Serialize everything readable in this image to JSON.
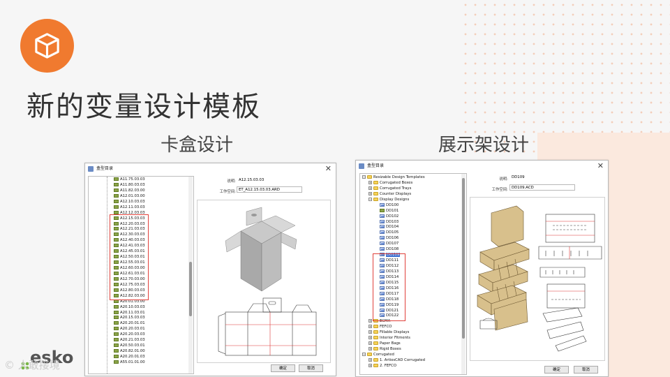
{
  "slide": {
    "title": "新的变量设计模板",
    "left_subtitle": "卡盒设计",
    "right_subtitle": "展示架设计",
    "brand": "esko",
    "watermark": "© 人敢接境"
  },
  "colors": {
    "accent": "#f07a2f",
    "highlight_box": "#e0403a",
    "selection": "#3b6fd1"
  },
  "left_window": {
    "title": "盒型目录",
    "close_glyph": "✕",
    "desc_label": "说明:",
    "desc_value": "A12.15.03.03",
    "workspace_label": "工作空间:",
    "workspace_value": "ET_A12.15.03.03.ARD",
    "ok_label": "确定",
    "cancel_label": "取消",
    "tree_items": [
      "A11.75.03.03",
      "A11.80.03.03",
      "A11.82.03.00",
      "A12.01.03.00",
      "A12.10.03.03",
      "A12.11.03.03",
      "A12.12.03.03",
      "A12.15.03.03",
      "A12.20.03.03",
      "A12.21.03.03",
      "A12.30.03.03",
      "A12.40.03.03",
      "A12.41.03.03",
      "A12.45.03.01",
      "A12.50.03.01",
      "A12.55.03.01",
      "A12.60.03.00",
      "A12.61.03.01",
      "A12.70.03.00",
      "A12.75.03.03",
      "A12.80.03.03",
      "A12.82.03.00",
      "A20.01.03.00",
      "A20.10.03.03",
      "A20.11.03.01",
      "A20.15.03.03",
      "A20.20.01.01",
      "A20.20.03.01",
      "A20.20.03.03",
      "A20.21.03.03",
      "A20.50.03.01",
      "A20.82.01.00",
      "A20.20.01.03",
      "A55.01.01.00"
    ]
  },
  "right_window": {
    "title": "盒型目录",
    "close_glyph": "✕",
    "desc_label": "说明:",
    "desc_value": "DD109",
    "workspace_label": "工作空间:",
    "workspace_value": "DD109.ACD",
    "ok_label": "确定",
    "cancel_label": "取消",
    "tree_items": [
      {
        "label": "Resizable Design Templates",
        "icon": "folder",
        "level": 0,
        "expander": "−"
      },
      {
        "label": "Corrugated Boxes",
        "icon": "folder",
        "level": 1,
        "expander": "+"
      },
      {
        "label": "Corrugated Trays",
        "icon": "folder",
        "level": 1,
        "expander": "+"
      },
      {
        "label": "Counter Displays",
        "icon": "folder",
        "level": 1,
        "expander": "+"
      },
      {
        "label": "Display Designs",
        "icon": "folder",
        "level": 1,
        "expander": "−"
      },
      {
        "label": "DD100",
        "icon": "doc",
        "level": 2
      },
      {
        "label": "DD101",
        "icon": "item",
        "level": 2
      },
      {
        "label": "DD102",
        "icon": "doc",
        "level": 2
      },
      {
        "label": "DD103",
        "icon": "doc",
        "level": 2
      },
      {
        "label": "DD104",
        "icon": "doc",
        "level": 2
      },
      {
        "label": "DD105",
        "icon": "doc",
        "level": 2
      },
      {
        "label": "DD106",
        "icon": "doc",
        "level": 2
      },
      {
        "label": "DD107",
        "icon": "doc",
        "level": 2
      },
      {
        "label": "DD108",
        "icon": "doc",
        "level": 2
      },
      {
        "label": "DD109",
        "icon": "doc",
        "level": 2,
        "selected": true
      },
      {
        "label": "DD111",
        "icon": "doc",
        "level": 2
      },
      {
        "label": "DD112",
        "icon": "doc",
        "level": 2
      },
      {
        "label": "DD113",
        "icon": "doc",
        "level": 2
      },
      {
        "label": "DD114",
        "icon": "doc",
        "level": 2
      },
      {
        "label": "DD115",
        "icon": "doc",
        "level": 2
      },
      {
        "label": "DD116",
        "icon": "doc",
        "level": 2
      },
      {
        "label": "DD117",
        "icon": "doc",
        "level": 2
      },
      {
        "label": "DD118",
        "icon": "doc",
        "level": 2
      },
      {
        "label": "DD119",
        "icon": "doc",
        "level": 2
      },
      {
        "label": "DD121",
        "icon": "doc",
        "level": 2
      },
      {
        "label": "DD122",
        "icon": "doc",
        "level": 2
      },
      {
        "label": "ECMA",
        "icon": "folder",
        "level": 1,
        "expander": "+"
      },
      {
        "label": "FEFCO",
        "icon": "folder",
        "level": 1,
        "expander": "+"
      },
      {
        "label": "Fillable Displays",
        "icon": "folder",
        "level": 1,
        "expander": "+"
      },
      {
        "label": "Interior Fitments",
        "icon": "folder",
        "level": 1,
        "expander": "+"
      },
      {
        "label": "Paper Bags",
        "icon": "folder",
        "level": 1,
        "expander": "+"
      },
      {
        "label": "Rigid Boxes",
        "icon": "folder",
        "level": 1,
        "expander": "+"
      },
      {
        "label": "Corrugated",
        "icon": "folder",
        "level": 0,
        "expander": "−"
      },
      {
        "label": "1. ArtiosCAD Corrugated",
        "icon": "folder",
        "level": 1,
        "expander": "+"
      },
      {
        "label": "2.    FEFCO",
        "icon": "folder",
        "level": 1,
        "expander": "+"
      }
    ]
  }
}
